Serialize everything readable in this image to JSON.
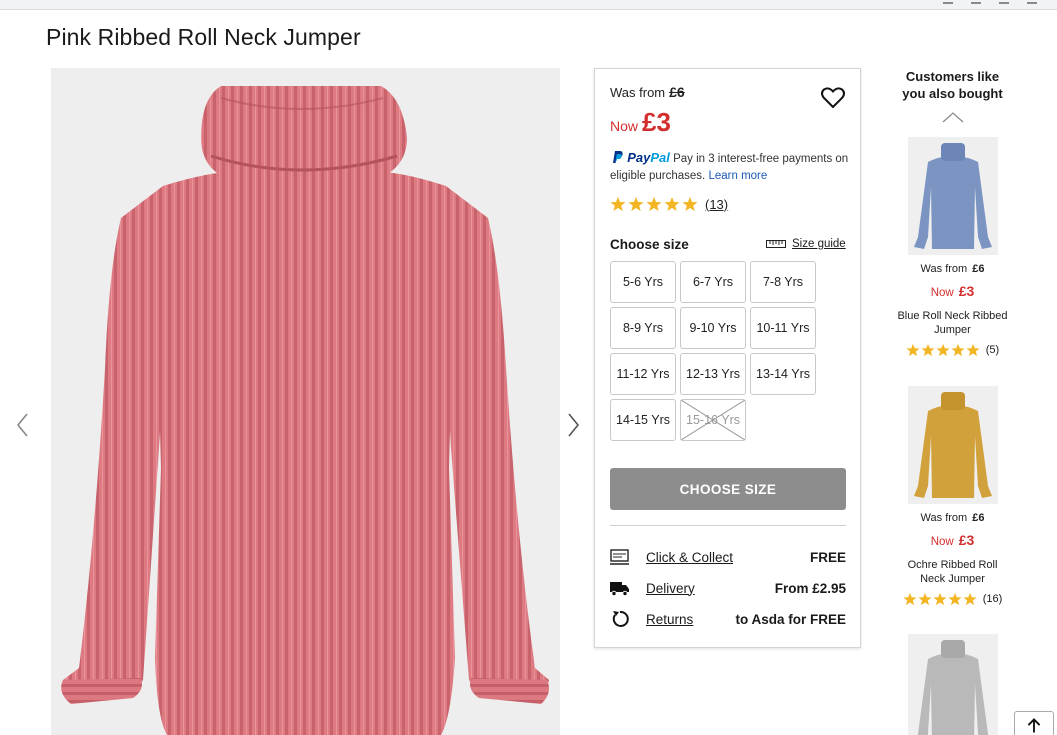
{
  "product": {
    "title": "Pink Ribbed Roll Neck Jumper"
  },
  "pricing": {
    "was_label": "Was from",
    "was_price": "£6",
    "now_label": "Now",
    "now_price": "£3",
    "accent_color": "#d32f2f"
  },
  "paypal": {
    "brand_pay": "Pay",
    "brand_pal": "Pal",
    "text": "Pay in 3 interest-free payments on eligible purchases.",
    "learn_more": "Learn more"
  },
  "rating": {
    "stars": 5,
    "count": "(13)"
  },
  "size_picker": {
    "title": "Choose size",
    "guide_label": "Size guide",
    "sizes": [
      {
        "label": "5-6 Yrs",
        "available": true
      },
      {
        "label": "6-7 Yrs",
        "available": true
      },
      {
        "label": "7-8 Yrs",
        "available": true
      },
      {
        "label": "8-9 Yrs",
        "available": true
      },
      {
        "label": "9-10 Yrs",
        "available": true
      },
      {
        "label": "10-11 Yrs",
        "available": true
      },
      {
        "label": "11-12 Yrs",
        "available": true
      },
      {
        "label": "12-13 Yrs",
        "available": true
      },
      {
        "label": "13-14 Yrs",
        "available": true
      },
      {
        "label": "14-15 Yrs",
        "available": true
      },
      {
        "label": "15-16 Yrs",
        "available": false
      }
    ]
  },
  "cta": {
    "label": "CHOOSE SIZE"
  },
  "delivery": [
    {
      "icon": "click-collect-icon",
      "label": "Click & Collect",
      "value": "FREE"
    },
    {
      "icon": "delivery-truck-icon",
      "label": "Delivery",
      "value": "From £2.95"
    },
    {
      "icon": "returns-icon",
      "label": "Returns",
      "value": "to Asda for FREE"
    }
  ],
  "recommendations": {
    "title": "Customers like you also bought",
    "items": [
      {
        "name": "Blue Roll Neck Ribbed Jumper",
        "was_label": "Was from",
        "was_price": "£6",
        "now_label": "Now",
        "now_price": "£3",
        "stars": 5,
        "count": "(5)",
        "color": "#7b94c2"
      },
      {
        "name": "Ochre Ribbed Roll Neck Jumper",
        "was_label": "Was from",
        "was_price": "£6",
        "now_label": "Now",
        "now_price": "£3",
        "stars": 5,
        "count": "(16)",
        "color": "#d1a13b"
      },
      {
        "name": "",
        "color": "#b9b9b9"
      }
    ]
  },
  "colors": {
    "jumper": "#de7b82",
    "star": "#f2b624",
    "cta_bg": "#8d8d8d"
  }
}
